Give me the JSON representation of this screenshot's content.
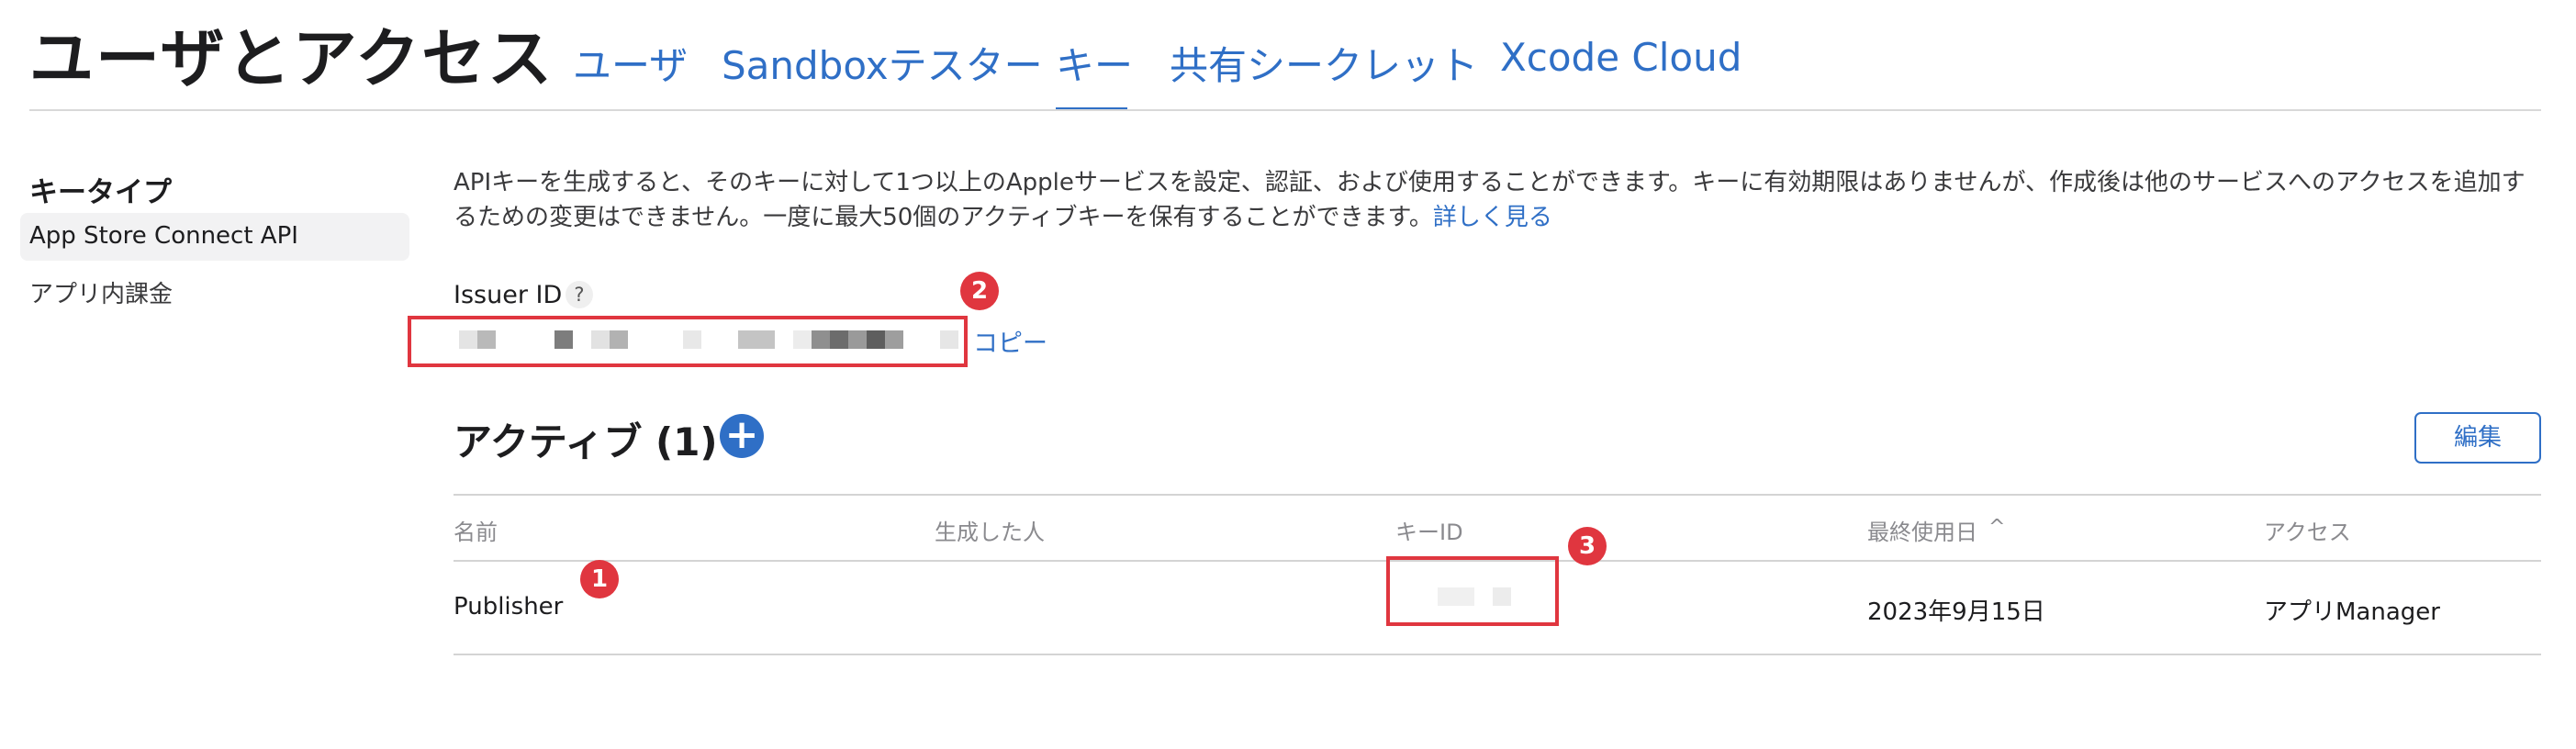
{
  "header": {
    "title": "ユーザとアクセス",
    "tabs": [
      {
        "label": "ユーザ"
      },
      {
        "label": "Sandboxテスター"
      },
      {
        "label": "キー",
        "active": true
      },
      {
        "label": "共有シークレット"
      },
      {
        "label": "Xcode Cloud"
      }
    ]
  },
  "sidebar": {
    "heading": "キータイプ",
    "items": [
      {
        "label": "App Store Connect API",
        "selected": true
      },
      {
        "label": "アプリ内課金"
      }
    ]
  },
  "intro": {
    "text": "APIキーを生成すると、そのキーに対して1つ以上のAppleサービスを設定、認証、および使用することができます。キーに有効期限はありませんが、作成後は他のサービスへのアクセスを追加するための変更はできません。一度に最大50個のアクティブキーを保有することができます。",
    "learn_more": "詳しく見る"
  },
  "issuer": {
    "label": "Issuer ID",
    "help": "?",
    "copy": "コピー"
  },
  "markers": {
    "one": "1",
    "two": "2",
    "three": "3"
  },
  "active": {
    "heading": "アクティブ (1)",
    "add": "+",
    "edit": "編集"
  },
  "table": {
    "columns": [
      "名前",
      "生成した人",
      "キーID",
      "最終使用日",
      "アクセス"
    ],
    "sort_indicator": "^",
    "rows": [
      {
        "name": "Publisher",
        "creator": "",
        "key_id": "",
        "last_used": "2023年9月15日",
        "access": "アプリManager"
      }
    ]
  },
  "colors": {
    "accent": "#2f6fc6",
    "annotation_red": "#e0363f"
  }
}
